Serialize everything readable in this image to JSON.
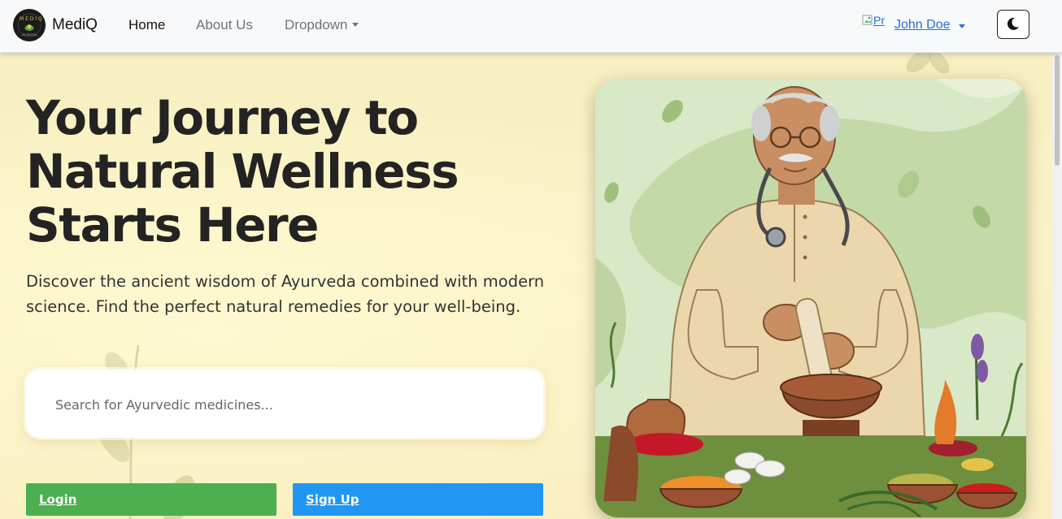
{
  "navbar": {
    "brand": "MediQ",
    "links": [
      "Home",
      "About Us",
      "Dropdown"
    ],
    "broken_img_alt": "Pr",
    "user_name": "John Doe",
    "theme_toggle_icon": "moon-icon"
  },
  "hero": {
    "headline_1": "Your Journey to",
    "headline_2": "Natural Wellness",
    "headline_3": "Starts Here",
    "subtext": "Discover the ancient wisdom of Ayurveda combined with modern science. Find the perfect natural remedies for your well-being.",
    "search_placeholder": "Search for Ayurvedic medicines...",
    "login_label": "Login",
    "signup_label": "Sign Up"
  },
  "colors": {
    "login_bg": "#4caf50",
    "signup_bg": "#2196f3",
    "hero_bg": "#fbf3c8"
  }
}
